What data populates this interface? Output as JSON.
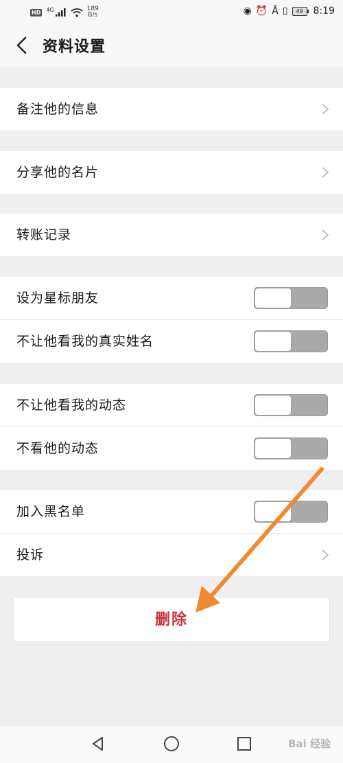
{
  "status_bar": {
    "hd": "HD",
    "network": "4G",
    "speed_value": "189",
    "speed_unit": "B/s",
    "battery": "49",
    "time": "8:19"
  },
  "header": {
    "title": "资料设置"
  },
  "groups": [
    {
      "items": [
        {
          "label": "备注他的信息"
        }
      ]
    },
    {
      "items": [
        {
          "label": "分享他的名片"
        }
      ]
    },
    {
      "items": [
        {
          "label": "转账记录"
        }
      ]
    },
    {
      "items": [
        {
          "label": "设为星标朋友",
          "toggle": false
        },
        {
          "label": "不让他看我的真实姓名",
          "toggle": false
        }
      ]
    },
    {
      "items": [
        {
          "label": "不让他看我的动态",
          "toggle": false
        },
        {
          "label": "不看他的动态",
          "toggle": false
        }
      ]
    },
    {
      "items": [
        {
          "label": "加入黑名单",
          "toggle": false
        },
        {
          "label": "投诉"
        }
      ]
    }
  ],
  "delete_button": {
    "label": "删除",
    "color": "#c8313a"
  },
  "annotation": {
    "arrow_color": "#f08a32"
  },
  "watermark": "Bai 经验"
}
